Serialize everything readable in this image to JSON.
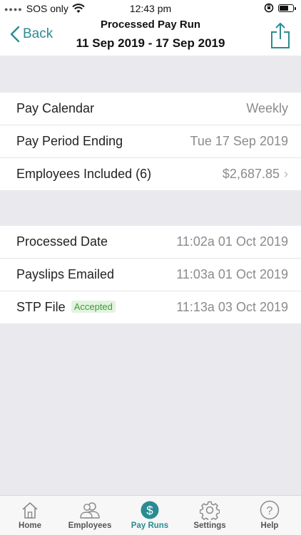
{
  "status_bar": {
    "carrier": "SOS only",
    "time": "12:43 pm"
  },
  "nav": {
    "back_label": "Back",
    "title": "Processed Pay Run",
    "subtitle": "11 Sep 2019 - 17 Sep 2019"
  },
  "summary": {
    "rows": [
      {
        "label": "Pay Calendar",
        "value": "Weekly"
      },
      {
        "label": "Pay Period Ending",
        "value": "Tue 17 Sep 2019"
      },
      {
        "label": "Employees Included (6)",
        "value": "$2,687.85"
      }
    ]
  },
  "processing": {
    "rows": [
      {
        "label": "Processed Date",
        "value": "11:02a 01 Oct 2019"
      },
      {
        "label": "Payslips Emailed",
        "value": "11:03a 01 Oct 2019"
      },
      {
        "label": "STP File",
        "badge": "Accepted",
        "value": "11:13a 03 Oct 2019"
      }
    ]
  },
  "tabs": [
    {
      "label": "Home",
      "icon": "home-icon"
    },
    {
      "label": "Employees",
      "icon": "employees-icon"
    },
    {
      "label": "Pay Runs",
      "icon": "dollar-icon",
      "active": true
    },
    {
      "label": "Settings",
      "icon": "gear-icon"
    },
    {
      "label": "Help",
      "icon": "help-icon"
    }
  ],
  "colors": {
    "accent": "#2a8c92",
    "badge_green": "#3a9d3a",
    "background": "#e9e9ee"
  }
}
